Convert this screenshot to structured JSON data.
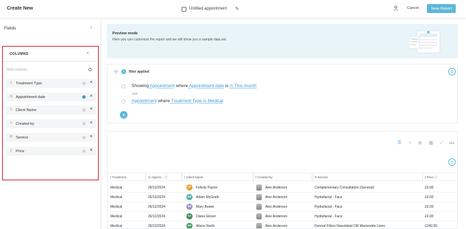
{
  "header": {
    "title": "Create New",
    "document_name": "Untitled appointment",
    "cancel_label": "Cancel",
    "save_label": "Save Report"
  },
  "sidebar": {
    "title": "Fields",
    "columns_heading": "COLUMNS",
    "add_placeholder": "Add column...",
    "items": [
      {
        "label": "Treatment Type",
        "type_icon": "text-icon"
      },
      {
        "label": "Appointment date",
        "type_icon": "clock-icon"
      },
      {
        "label": "Client Name",
        "type_icon": "text-icon"
      },
      {
        "label": "Created by",
        "type_icon": "text-icon"
      },
      {
        "label": "Service",
        "type_icon": "search-icon"
      },
      {
        "label": "Price",
        "type_icon": "currency-icon"
      }
    ]
  },
  "banner": {
    "title": "Preview mode",
    "description": "Here you can customize the report and we will show you a sample data set."
  },
  "filters": {
    "count": "1",
    "applied_label": "filter applied",
    "rule1": {
      "w1": "Showing",
      "f1": "Appointment",
      "w2": "where",
      "f2": "Appointment date",
      "w3": "is",
      "w4": "in",
      "f3": "This month"
    },
    "and_label": "and",
    "rule2": {
      "f1": "Appointment",
      "w1": "where",
      "f2": "Treatment Type is Medical"
    },
    "add_label": "+"
  },
  "table": {
    "columns": [
      "Treatment...",
      "Appoin...",
      "Client Name",
      "Created by",
      "Service",
      "Price"
    ],
    "view_tools": [
      "list-view-icon",
      "pie-view-icon",
      "donut-view-icon",
      "bar-view-icon",
      "line-view-icon",
      "123"
    ],
    "rows": [
      {
        "type": "Medical",
        "date": "26/12/2024",
        "initials": "FP",
        "color": "#e8a33a",
        "client": "Felicity Payne",
        "created_by": "Alex Anderson",
        "service": "Complementary Consultation (General)",
        "price": "£0.00"
      },
      {
        "type": "Medical",
        "date": "26/12/2024",
        "initials": "AM",
        "color": "#4db6ac",
        "client": "Adam McGrath",
        "created_by": "Alex Anderson",
        "service": "Hydrafacial - Face",
        "price": "£0.00"
      },
      {
        "type": "Medical",
        "date": "26/12/2024",
        "initials": "MB",
        "color": "#9e8fc7",
        "client": "Mary Bower",
        "created_by": "Alex Anderson",
        "service": "Hydrafacial - Face",
        "price": "£0.00"
      },
      {
        "type": "Medical",
        "date": "26/12/2024",
        "initials": "DG",
        "color": "#3d8b5a",
        "client": "Diana Glover",
        "created_by": "Alex Anderson",
        "service": "Hydrafacial - Face",
        "price": "£0.00"
      },
      {
        "type": "Medical",
        "date": "26/12/2024",
        "initials": "AN",
        "color": "#4a9d6b",
        "client": "Alison North",
        "created_by": "Alex Anderson",
        "service": "Dermal Fillers Nasolabial OR Marionette Lines",
        "price": "£240.00"
      }
    ]
  }
}
